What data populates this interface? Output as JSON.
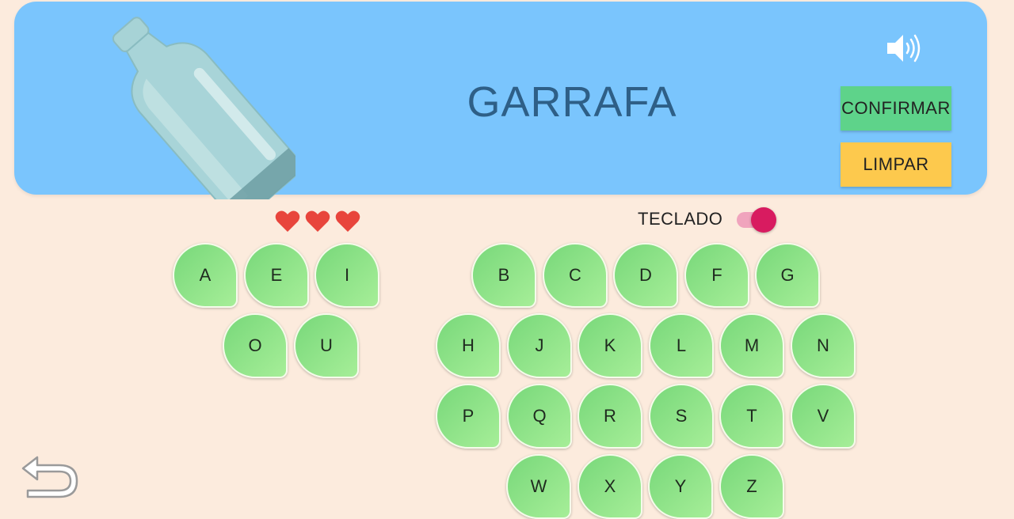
{
  "word": "GARRAFA",
  "buttons": {
    "confirm": "CONFIRMAR",
    "clear": "LIMPAR"
  },
  "lives": 3,
  "toggle": {
    "label": "TECLADO",
    "on": true
  },
  "icons": {
    "image": "bottle-icon",
    "audio": "speaker-icon",
    "life": "heart-icon",
    "back": "undo-arrow-icon"
  },
  "colors": {
    "panel": "#7ac5fd",
    "background": "#fcebdd",
    "confirm": "#5ed38a",
    "clear": "#fdc94d",
    "heart": "#e8453c",
    "toggle": "#d81b60",
    "key": "#8fe389"
  },
  "vowels": {
    "row1": [
      "A",
      "E",
      "I"
    ],
    "row2": [
      "O",
      "U"
    ]
  },
  "consonants": {
    "row1": [
      "B",
      "C",
      "D",
      "F",
      "G"
    ],
    "row2": [
      "H",
      "J",
      "K",
      "L",
      "M",
      "N"
    ],
    "row3": [
      "P",
      "Q",
      "R",
      "S",
      "T",
      "V"
    ],
    "row4": [
      "W",
      "X",
      "Y",
      "Z"
    ]
  }
}
